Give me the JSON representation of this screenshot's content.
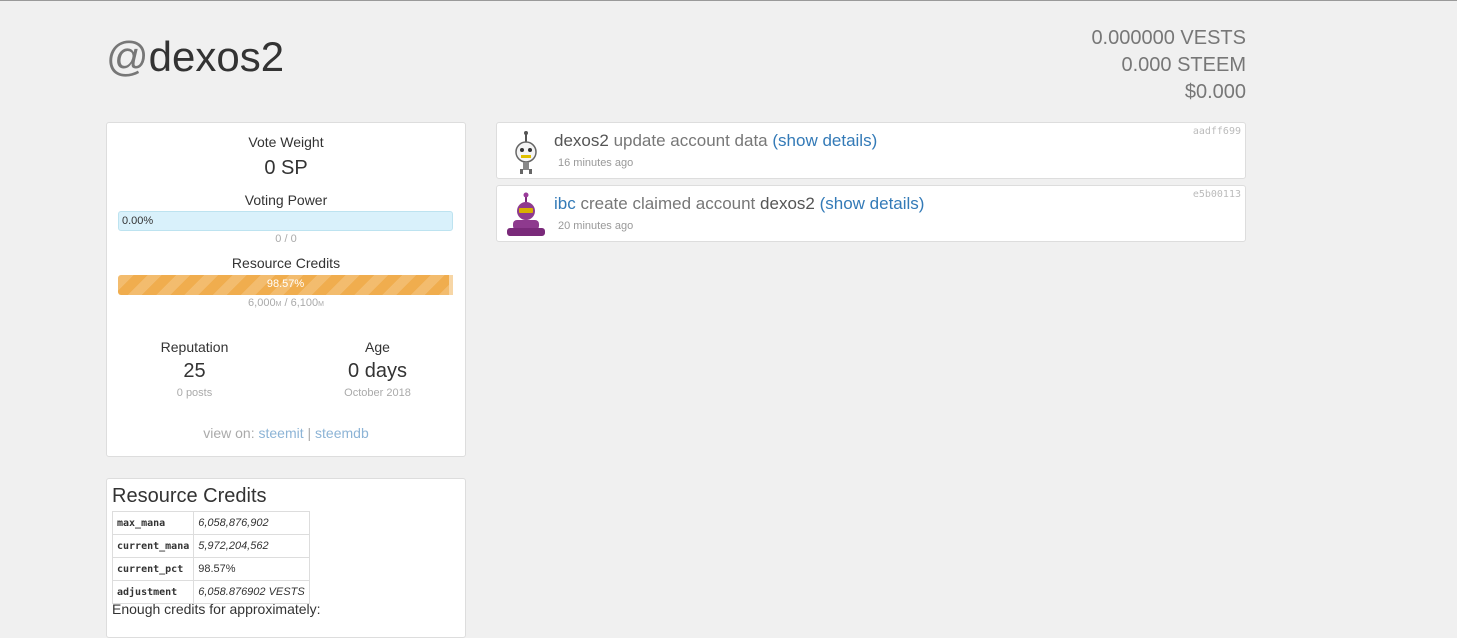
{
  "header": {
    "at": "@",
    "username": "dexos2",
    "vests": "0.000000 VESTS",
    "steem": "0.000 STEEM",
    "usd": "$0.000"
  },
  "stats": {
    "vote_weight_label": "Vote Weight",
    "vote_weight_value": "0 SP",
    "voting_power_label": "Voting Power",
    "voting_power_pct": "0.00%",
    "voting_power_fraction": 0.0,
    "voting_power_sub": "0 / 0",
    "rc_label": "Resource Credits",
    "rc_pct": "98.57%",
    "rc_fraction": 0.9857,
    "rc_current": "6,000",
    "rc_max": "6,100",
    "rc_unit": "M",
    "rc_sep": " / ",
    "reputation_label": "Reputation",
    "reputation_value": "25",
    "reputation_sub": "0 posts",
    "age_label": "Age",
    "age_value": "0 days",
    "age_sub": "October 2018",
    "view_on_label": "view on:",
    "link_steemit": "steemit",
    "link_sep": "|",
    "link_steemdb": "steemdb"
  },
  "ops": [
    {
      "actor": "dexos2",
      "action": "update account data",
      "details": "(show details)",
      "time": "16 minutes ago",
      "hash": "aadff699"
    },
    {
      "actor": "ibc",
      "action": "create claimed account",
      "target": "dexos2",
      "details": "(show details)",
      "time": "20 minutes ago",
      "hash": "e5b00113"
    }
  ],
  "rc_panel": {
    "title": "Resource Credits",
    "rows": [
      {
        "key": "max_mana",
        "value": "6,058,876,902"
      },
      {
        "key": "current_mana",
        "value": "5,972,204,562"
      },
      {
        "key": "current_pct",
        "value": "98.57%"
      },
      {
        "key": "adjustment",
        "value": "6,058.876902 VESTS"
      }
    ],
    "enough": "Enough credits for approximately:"
  },
  "colors": {
    "link": "#337ab7",
    "rc_bar": "#f0ad4e",
    "vp_bar": "#d9f1fb"
  }
}
